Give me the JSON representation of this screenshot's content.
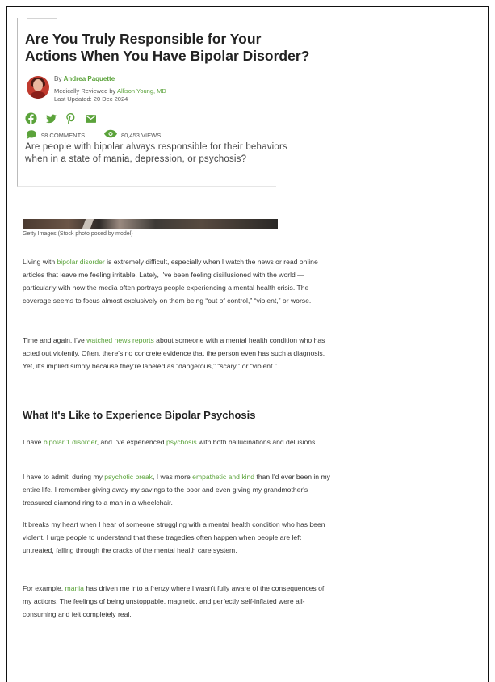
{
  "article": {
    "title": "Are You Truly Responsible for Your Actions When You Have Bipolar Disorder?",
    "byline": {
      "prefix": "By",
      "author": "Andrea Paquette",
      "reviewed_prefix": "Medically Reviewed by",
      "reviewer": "Allison Young, MD",
      "updated": "Last Updated: 20 Dec 2024"
    },
    "social_icons": [
      "facebook-icon",
      "twitter-icon",
      "pinterest-icon",
      "email-icon"
    ],
    "stats": {
      "comments": "98 COMMENTS",
      "views": "80,453 VIEWS"
    },
    "summary": "Are people with bipolar always responsible for their behaviors when in a state of mania, depression, or psychosis?",
    "image_caption": "Getty Images (Stock photo posed by model)",
    "p1": {
      "a": "Living with ",
      "link": "bipolar disorder",
      "b": " is extremely difficult, especially when I watch the news or read online articles that leave me feeling irritable. Lately, I've been feeling disillusioned with the world — particularly with how the media often portrays people experiencing a mental health crisis. The coverage seems to focus almost exclusively on them being “out of control,” “violent,” or worse."
    },
    "p2": {
      "a": "Time and again, I've ",
      "link": "watched news reports",
      "b": " about someone with a mental health condition who has acted out violently. Often, there's no concrete evidence that the person even has such a diagnosis. Yet, it's implied simply because they're labeled as “dangerous,” “scary,” or “violent.”"
    },
    "heading": "What It's Like to Experience Bipolar Psychosis",
    "p3": {
      "a": "I have ",
      "link1": "bipolar 1 disorder",
      "b": ", and I've experienced ",
      "link2": "psychosis",
      "c": " with both hallucinations and delusions."
    },
    "p4": {
      "a": "I have to admit, during my ",
      "link1": "psychotic break",
      "b": ", I was more ",
      "link2": "empathetic and kind",
      "c": " than I'd ever been in my entire life. I remember giving away my savings to the poor and even giving my grandmother's treasured diamond ring to a man in a wheelchair."
    },
    "p5": "It breaks my heart when I hear of someone struggling with a mental health condition who has been violent. I urge people to understand that these tragedies often happen when people are left untreated, falling through the cracks of the mental health care system.",
    "p6": {
      "a": "For example, ",
      "link": "mania",
      "b": " has driven me into a frenzy where I wasn't fully aware of the consequences of my actions. The feelings of being unstoppable, magnetic, and perfectly self-inflated were all-consuming and felt completely real."
    }
  },
  "colors": {
    "accent": "#5ba33b",
    "text": "#333333",
    "heading": "#222222"
  }
}
